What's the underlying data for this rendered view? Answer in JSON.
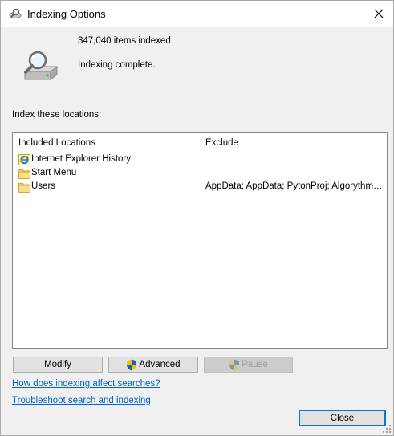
{
  "window": {
    "title": "Indexing Options"
  },
  "status": {
    "items_count": "347,040 items indexed",
    "message": "Indexing complete."
  },
  "locations_label": "Index these locations:",
  "list": {
    "col_included": "Included Locations",
    "col_exclude": "Exclude",
    "rows": [
      {
        "name": "Internet Explorer History",
        "exclude": "",
        "icon": "internet-explorer-icon"
      },
      {
        "name": "Start Menu",
        "exclude": "",
        "icon": "folder-icon"
      },
      {
        "name": "Users",
        "exclude": "AppData; AppData; PytonProj; Algorythm…",
        "icon": "folder-icon"
      }
    ]
  },
  "buttons": {
    "modify": "Modify",
    "advanced": "Advanced",
    "pause": "Pause",
    "close": "Close"
  },
  "links": {
    "how": "How does indexing affect searches?",
    "troubleshoot": "Troubleshoot search and indexing"
  },
  "colors": {
    "accent": "#0078d7",
    "link": "#0066cc"
  }
}
